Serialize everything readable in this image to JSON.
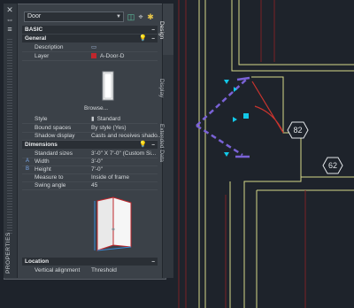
{
  "palette": {
    "style_select": "Door",
    "strip_label": "PROPERTIES",
    "tabs": {
      "design": "Design",
      "display": "Display",
      "extended": "Extended Data"
    },
    "sections": {
      "basic": "BASIC",
      "general": "General",
      "dimensions": "Dimensions",
      "location": "Location"
    },
    "collapse_glyph": "–",
    "general": {
      "description_label": "Description",
      "layer_label": "Layer",
      "layer_value": "A-Door-D",
      "layer_color": "#c0262c",
      "browse_label": "Browse...",
      "style_label": "Style",
      "style_value": "Standard",
      "bound_label": "Bound spaces",
      "bound_value": "By style (Yes)",
      "shadow_label": "Shadow display",
      "shadow_value": "Casts and receives shado..."
    },
    "dimensions": {
      "std_label": "Standard sizes",
      "std_value": "3'-0\" X 7'-0\" (Custom Si...",
      "width_marker": "A",
      "width_label": "Width",
      "width_value": "3'-0\"",
      "height_marker": "B",
      "height_label": "Height",
      "height_value": "7'-0\"",
      "measure_label": "Measure to",
      "measure_value": "Inside of frame",
      "swing_label": "Swing angle",
      "swing_value": "45"
    },
    "location": {
      "vertical_label": "Vertical alignment",
      "vertical_value": "Threshold"
    }
  },
  "drawing": {
    "tag1": "82",
    "tag2": "62",
    "colors": {
      "wall": "#d6d98a",
      "grid": "#7a2226",
      "door": "#7a62d6",
      "grip": "#12c8e8",
      "background": "#1e232b"
    }
  }
}
